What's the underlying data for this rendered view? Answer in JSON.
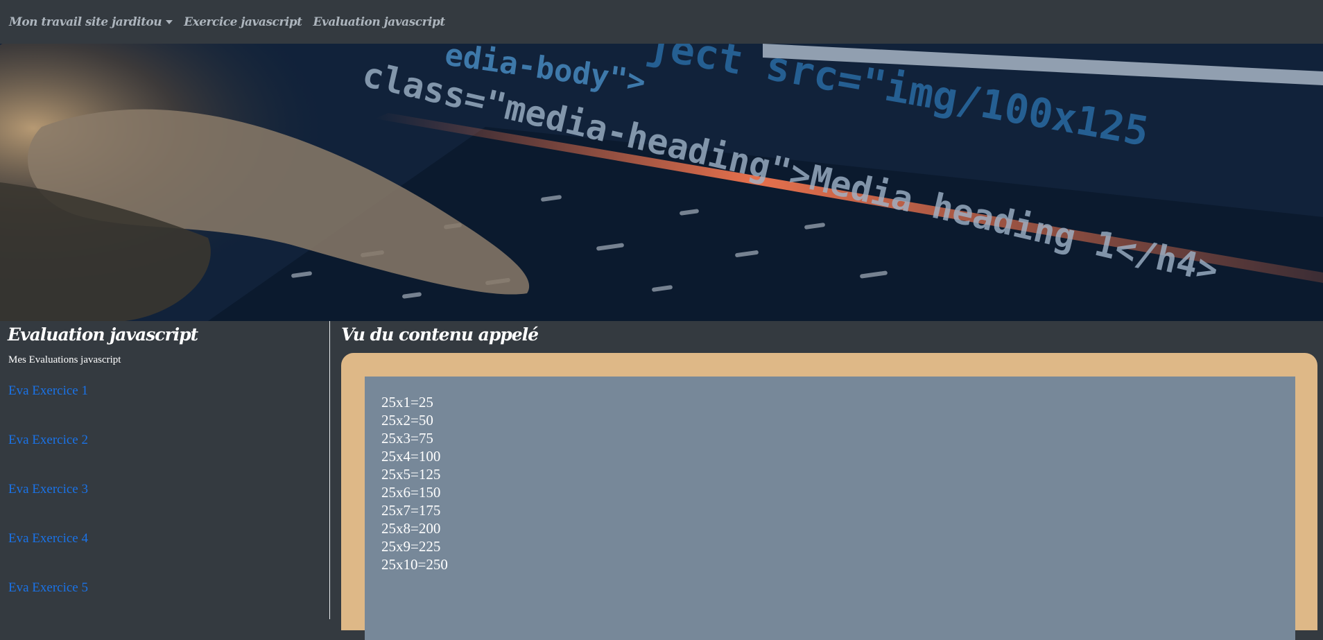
{
  "navbar": {
    "items": [
      {
        "label": "Mon travail  site jarditou",
        "dropdown": true
      },
      {
        "label": "Exercice javascript"
      },
      {
        "label": "Evaluation javascript"
      }
    ]
  },
  "banner": {
    "code_lines": [
      "edia-body\">",
      "ject  src=\"img/100x125",
      "class=\"media-heading\">Media heading 1</h4>"
    ]
  },
  "sidebar": {
    "title": "Evaluation javascript",
    "subtitle": "Mes Evaluations javascript",
    "links": [
      "Eva Exercice 1",
      "Eva Exercice 2",
      "Eva Exercice 3",
      "Eva Exercice 4",
      "Eva Exercice 5"
    ]
  },
  "main": {
    "title": "Vu du contenu appelé",
    "results": [
      "25x1=25",
      "25x2=50",
      "25x3=75",
      "25x4=100",
      "25x5=125",
      "25x6=150",
      "25x7=175",
      "25x8=200",
      "25x9=225",
      "25x10=250"
    ]
  },
  "colors": {
    "background": "#343a40",
    "frame": "#deb887",
    "content": "#778899",
    "link": "#1a73e8"
  }
}
